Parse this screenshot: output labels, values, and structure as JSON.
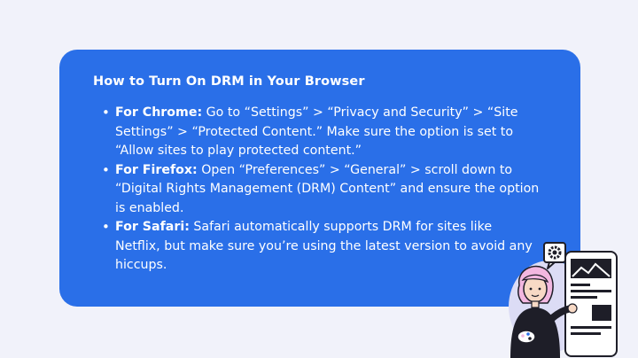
{
  "title": "How to Turn On DRM in Your Browser",
  "tips": [
    {
      "label": "For Chrome:",
      "text": "Go to “Settings” > “Privacy and Security” > “Site Settings” > “Protected Content.” Make sure the option is set to “Allow sites to play protected content.”"
    },
    {
      "label": "For Firefox:",
      "text": "Open “Preferences” > “General” > scroll down to “Digital Rights Management (DRM) Content” and ensure the option is enabled."
    },
    {
      "label": "For Safari:",
      "text": "Safari automatically supports DRM for sites like Netflix, but make sure you’re using the latest version to avoid any hiccups."
    }
  ],
  "colors": {
    "background": "#f1f2fa",
    "card": "#2a6fe8",
    "text": "#ffffff"
  }
}
